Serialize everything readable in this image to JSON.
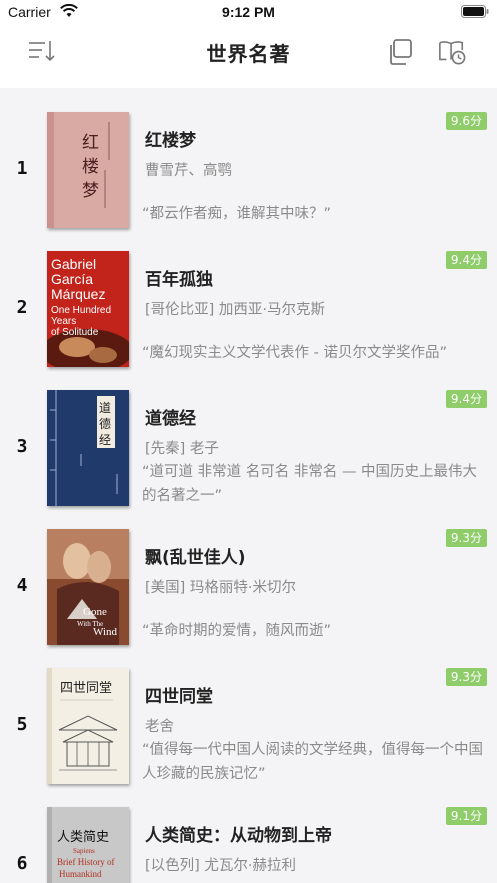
{
  "status_bar": {
    "carrier": "Carrier",
    "time": "9:12 PM"
  },
  "nav": {
    "title": "世界名著",
    "icons": [
      "sort-icon",
      "copy-icon",
      "history-book-icon"
    ]
  },
  "books": [
    {
      "rank": "1",
      "title": "红楼梦",
      "author": "曹雪芹、高鹗",
      "quote": "“都云作者痴，谁解其中味？”",
      "score": "9.6分",
      "cover_title": "红楼梦"
    },
    {
      "rank": "2",
      "title": "百年孤独",
      "author": "[哥伦比亚] 加西亚·马尔克斯",
      "quote": "“魔幻现实主义文学代表作 - 诺贝尔文学奖作品”",
      "score": "9.4分",
      "cover_lines": [
        "Gabriel",
        "García",
        "Márquez",
        "One Hundred",
        "Years",
        "of Solitude"
      ]
    },
    {
      "rank": "3",
      "title": "道德经",
      "author": "[先秦] 老子",
      "quote": "“道可道 非常道 名可名 非常名 — 中国历史上最伟大的名著之一”",
      "score": "9.4分",
      "cover_title": "道德经"
    },
    {
      "rank": "4",
      "title": "飘(乱世佳人)",
      "author": "[美国] 玛格丽特·米切尔",
      "quote": "“革命时期的爱情，随风而逝”",
      "score": "9.3分",
      "cover_lines": [
        "Gone",
        "With The",
        "Wind"
      ]
    },
    {
      "rank": "5",
      "title": "四世同堂",
      "author": "老舍",
      "quote": "“值得每一代中国人阅读的文学经典，值得每一个中国人珍藏的民族记忆”",
      "score": "9.3分",
      "cover_title": "四世同堂"
    },
    {
      "rank": "6",
      "title": "人类简史：从动物到上帝",
      "author": "[以色列] 尤瓦尔·赫拉利",
      "quote": "",
      "score": "9.1分",
      "cover_title": "人类简史",
      "cover_lines": [
        "Sapiens",
        "Brief History of",
        "Humankind"
      ]
    }
  ],
  "colors": {
    "score_badge": "#8fcc6a",
    "background": "#f4f4f6",
    "secondary_text": "#8a8a8a"
  }
}
